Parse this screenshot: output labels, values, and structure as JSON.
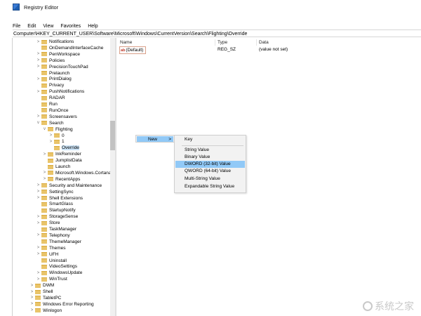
{
  "window": {
    "title": "Registry Editor"
  },
  "menu": [
    "File",
    "Edit",
    "View",
    "Favorites",
    "Help"
  ],
  "address": "Computer\\HKEY_CURRENT_USER\\Software\\Microsoft\\Windows\\CurrentVersion\\Search\\Flighting\\Override",
  "tree": [
    {
      "label": "Notifications",
      "indent": 0,
      "chev": ">"
    },
    {
      "label": "OnDemandInterfaceCache",
      "indent": 0,
      "chev": ""
    },
    {
      "label": "PenWorkspace",
      "indent": 0,
      "chev": ">"
    },
    {
      "label": "Policies",
      "indent": 0,
      "chev": ">"
    },
    {
      "label": "PrecisionTouchPad",
      "indent": 0,
      "chev": ">"
    },
    {
      "label": "Prelaunch",
      "indent": 0,
      "chev": ""
    },
    {
      "label": "PrintDialog",
      "indent": 0,
      "chev": ">"
    },
    {
      "label": "Privacy",
      "indent": 0,
      "chev": ""
    },
    {
      "label": "PushNotifications",
      "indent": 0,
      "chev": ">"
    },
    {
      "label": "RADAR",
      "indent": 0,
      "chev": ""
    },
    {
      "label": "Run",
      "indent": 0,
      "chev": ""
    },
    {
      "label": "RunOnce",
      "indent": 0,
      "chev": ""
    },
    {
      "label": "Screensavers",
      "indent": 0,
      "chev": ">"
    },
    {
      "label": "Search",
      "indent": 0,
      "chev": "v"
    },
    {
      "label": "Flighting",
      "indent": 1,
      "chev": "v"
    },
    {
      "label": "0",
      "indent": 2,
      "chev": ">"
    },
    {
      "label": "1",
      "indent": 2,
      "chev": ">"
    },
    {
      "label": "Override",
      "indent": 2,
      "chev": "",
      "selected": true
    },
    {
      "label": "InkReminder",
      "indent": 1,
      "chev": ">"
    },
    {
      "label": "JumplistData",
      "indent": 1,
      "chev": ""
    },
    {
      "label": "Launch",
      "indent": 1,
      "chev": ""
    },
    {
      "label": "Microsoft.Windows.Cortana_",
      "indent": 1,
      "chev": ">"
    },
    {
      "label": "RecentApps",
      "indent": 1,
      "chev": ">"
    },
    {
      "label": "Security and Maintenance",
      "indent": 0,
      "chev": ">"
    },
    {
      "label": "SettingSync",
      "indent": 0,
      "chev": ">"
    },
    {
      "label": "Shell Extensions",
      "indent": 0,
      "chev": ">"
    },
    {
      "label": "SmartGlass",
      "indent": 0,
      "chev": ""
    },
    {
      "label": "StartupNotify",
      "indent": 0,
      "chev": ""
    },
    {
      "label": "StorageSense",
      "indent": 0,
      "chev": ">"
    },
    {
      "label": "Store",
      "indent": 0,
      "chev": ">"
    },
    {
      "label": "TaskManager",
      "indent": 0,
      "chev": ""
    },
    {
      "label": "Telephony",
      "indent": 0,
      "chev": ">"
    },
    {
      "label": "ThemeManager",
      "indent": 0,
      "chev": ""
    },
    {
      "label": "Themes",
      "indent": 0,
      "chev": ">"
    },
    {
      "label": "UFH",
      "indent": 0,
      "chev": ">"
    },
    {
      "label": "Uninstall",
      "indent": 0,
      "chev": ""
    },
    {
      "label": "VideoSettings",
      "indent": 0,
      "chev": ""
    },
    {
      "label": "WindowsUpdate",
      "indent": 0,
      "chev": ">"
    },
    {
      "label": "WinTrust",
      "indent": 0,
      "chev": ">"
    },
    {
      "label": "DWM",
      "indent": -1,
      "chev": ">"
    },
    {
      "label": "Shell",
      "indent": -1,
      "chev": ">"
    },
    {
      "label": "TabletPC",
      "indent": -1,
      "chev": ">"
    },
    {
      "label": "Windows Error Reporting",
      "indent": -1,
      "chev": ">"
    },
    {
      "label": "Winlogon",
      "indent": -1,
      "chev": ">"
    }
  ],
  "columns": {
    "name": "Name",
    "type": "Type",
    "data": "Data"
  },
  "values": [
    {
      "name": "(Default)",
      "type": "REG_SZ",
      "data": "(value not set)",
      "icon": "ab"
    }
  ],
  "context_menu": {
    "new_label": "New",
    "arrow": ">"
  },
  "submenu": {
    "key": "Key",
    "items": [
      "String Value",
      "Binary Value",
      "DWORD (32-bit) Value",
      "QWORD (64-bit) Value",
      "Multi-String Value",
      "Expandable String Value"
    ],
    "highlighted": "DWORD (32-bit) Value"
  },
  "watermark": "系统之家"
}
